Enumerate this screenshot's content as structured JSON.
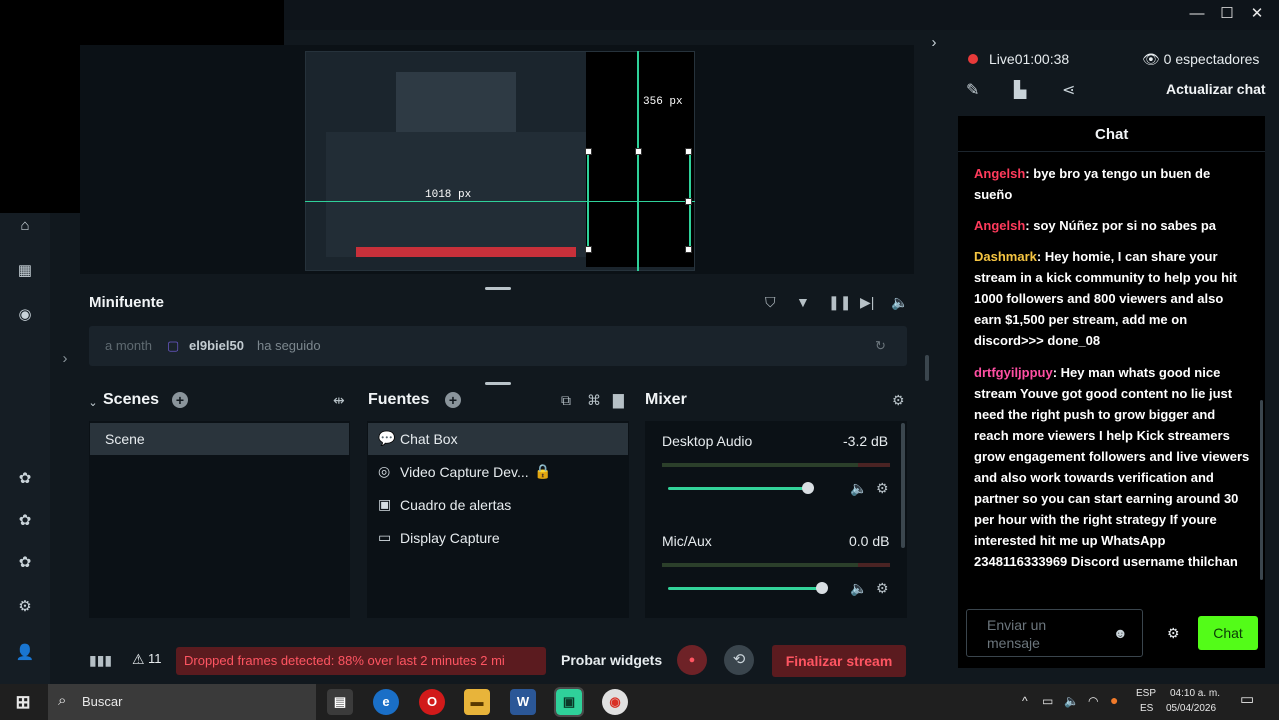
{
  "window": {
    "minimize": "—",
    "maximize": "☐",
    "close": "✕"
  },
  "preview": {
    "width_label": "356 px",
    "height_label": "1018 px"
  },
  "minifuente": {
    "title": "Minifuente",
    "event_time": "a month",
    "event_user": "el9biel50",
    "event_text": "ha seguido"
  },
  "scenes": {
    "title": "Scenes",
    "items": [
      "Scene"
    ]
  },
  "sources": {
    "title": "Fuentes",
    "items": [
      {
        "label": "Chat Box",
        "icon": "chat-icon"
      },
      {
        "label": "Video Capture Dev...",
        "icon": "camera-icon"
      },
      {
        "label": "Cuadro de alertas",
        "icon": "alert-box-icon"
      },
      {
        "label": "Display Capture",
        "icon": "monitor-icon"
      }
    ]
  },
  "mixer": {
    "title": "Mixer",
    "channels": [
      {
        "name": "Desktop Audio",
        "db": "-3.2 dB",
        "level": 0.88
      },
      {
        "name": "Mic/Aux",
        "db": "0.0 dB",
        "level": 0.94
      }
    ]
  },
  "footer": {
    "warning_count": "11",
    "dropped_frames": "Dropped frames detected: 88% over last 2 minutes 2 mi",
    "probar_widgets": "Probar widgets",
    "finalizar": "Finalizar stream"
  },
  "stream": {
    "live_label": "Live",
    "live_time": "01:00:38",
    "viewers": "0 espectadores",
    "refresh_chat": "Actualizar chat"
  },
  "chat": {
    "title": "Chat",
    "messages": [
      {
        "user": "Angelsh",
        "user_color": "#ff3b5c",
        "text": "bye bro ya tengo un buen de sueño"
      },
      {
        "user": "Angelsh",
        "user_color": "#ff3b5c",
        "text": "soy Núñez por si no sabes pa"
      },
      {
        "user": "Dashmark",
        "user_color": "#f5c542",
        "text": "Hey homie, I can share your stream in a kick community to help you hit 1000 followers and 800 viewers and also earn $1,500 per stream, add me on discord>>> done_08"
      },
      {
        "user": "drtfgyiljppuy",
        "user_color": "#ff4fa3",
        "text": "Hey man whats good nice stream Youve got good content no lie just need the right push to grow bigger and reach more viewers I help Kick streamers grow engagement followers and live viewers and also work towards verification and partner so you can start earning around 30 per hour with the right strategy If youre interested hit me up WhatsApp 2348116333969 Discord username thilchan"
      }
    ],
    "input_placeholder": "Enviar un mensaje",
    "send_label": "Chat"
  },
  "taskbar": {
    "search": "Buscar",
    "lang_top": "ESP",
    "lang_bottom": "ES",
    "time": "04:10 a. m.",
    "date": "05/04/2026"
  },
  "colors": {
    "accent": "#33d39a",
    "kick_green": "#53fc18",
    "danger": "#ff5562"
  }
}
